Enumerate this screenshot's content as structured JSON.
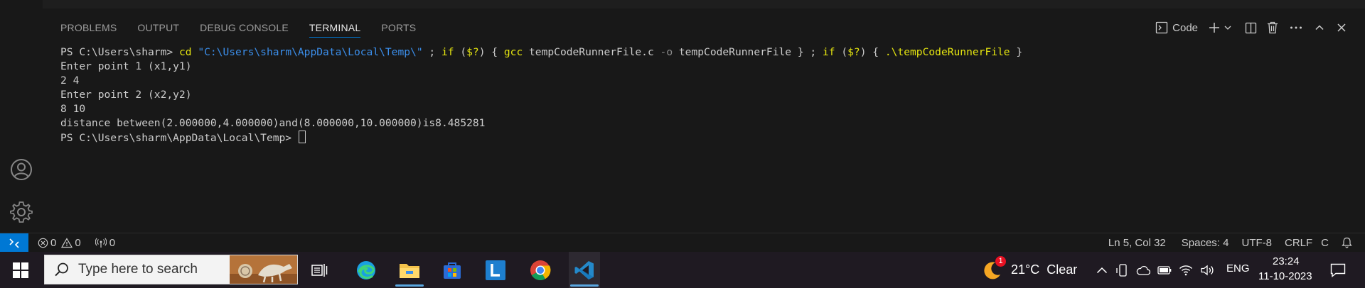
{
  "panel": {
    "tabs": [
      "PROBLEMS",
      "OUTPUT",
      "DEBUG CONSOLE",
      "TERMINAL",
      "PORTS"
    ],
    "active_tab": "TERMINAL",
    "terminal_profile": "Code"
  },
  "terminal": {
    "line1": {
      "prompt": "PS C:\\Users\\sharm> ",
      "cmd_cd": "cd",
      "path": "\"C:\\Users\\sharm\\AppData\\Local\\Temp\\\"",
      "sep1": " ; ",
      "if1": "if",
      "cond1_open": " (",
      "cond1": "$?",
      "cond1_close": ") { ",
      "cmd_gcc": "gcc",
      "gcc_args1": " tempCodeRunnerFile.c ",
      "flag_o": "-o",
      "gcc_args2": " tempCodeRunnerFile } ; ",
      "if2": "if",
      "cond2_open": " (",
      "cond2": "$?",
      "cond2_close": ") { ",
      "run": ".\\tempCodeRunnerFile",
      "end": " }"
    },
    "line2": "Enter point 1 (x1,y1)",
    "line3": "2 4",
    "line4": "Enter point 2 (x2,y2)",
    "line5": "8 10",
    "line6": "distance between(2.000000,4.000000)and(8.000000,10.000000)is8.485281",
    "line7": "PS C:\\Users\\sharm\\AppData\\Local\\Temp> "
  },
  "statusbar": {
    "errors": "0",
    "warnings": "0",
    "ports": "0",
    "position": "Ln 5, Col 32",
    "spaces": "Spaces: 4",
    "encoding": "UTF-8",
    "eol": "CRLF",
    "language": "C"
  },
  "taskbar": {
    "search_placeholder": "Type here to search",
    "weather_temp": "21°C",
    "weather_desc": "Clear",
    "weather_badge": "1",
    "language": "ENG",
    "time": "23:24",
    "date": "11-10-2023"
  },
  "colors": {
    "accent": "#0078d4",
    "terminal_yellow": "#e5e510",
    "terminal_blue": "#3b8eea"
  }
}
